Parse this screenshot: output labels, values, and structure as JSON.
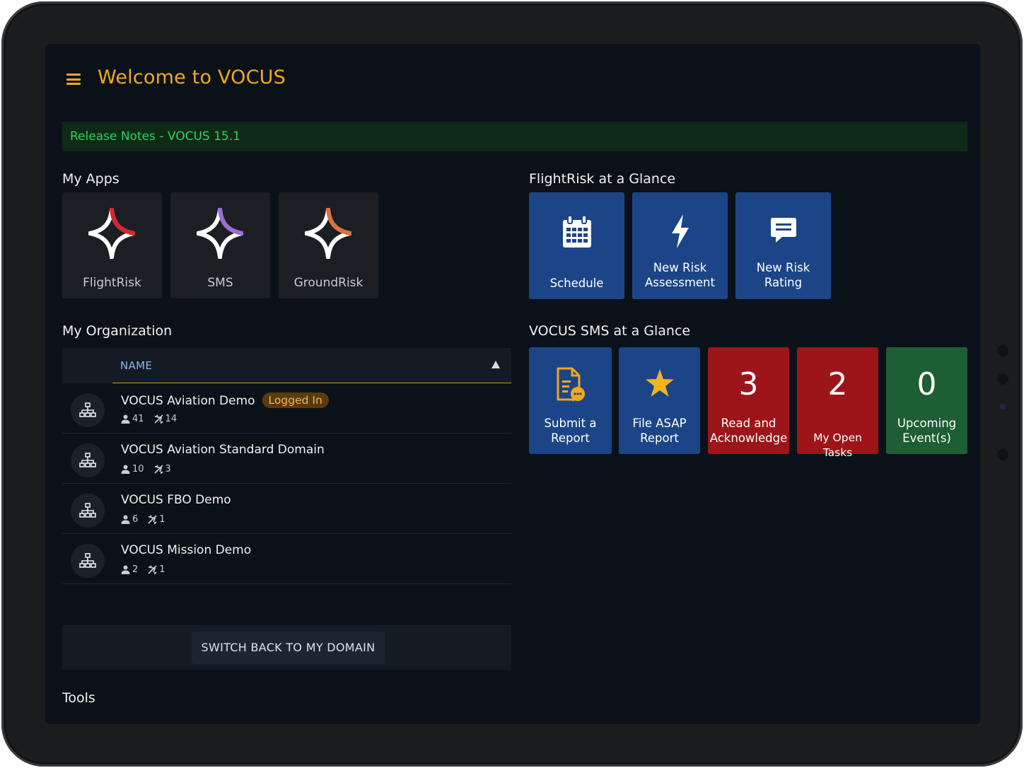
{
  "header": {
    "menu_icon": "hamburger-icon",
    "title": "Welcome to VOCUS"
  },
  "release_notes": "Release Notes - VOCUS 15.1",
  "my_apps": {
    "title": "My Apps",
    "apps": [
      {
        "label": "FlightRisk",
        "icon": "vocus-star-icon",
        "accent": "#d9262c"
      },
      {
        "label": "SMS",
        "icon": "vocus-star-icon",
        "accent": "#9a6dd7"
      },
      {
        "label": "GroundRisk",
        "icon": "vocus-star-icon",
        "accent": "#e0703a"
      }
    ]
  },
  "flightrisk_glance": {
    "title": "FlightRisk at a Glance",
    "tiles": [
      {
        "label": "Schedule",
        "icon": "calendar-icon"
      },
      {
        "label_line1": "New Risk",
        "label_line2": "Assessment",
        "icon": "lightning-icon"
      },
      {
        "label_line1": "New Risk",
        "label_line2": "Rating",
        "icon": "comment-icon"
      }
    ]
  },
  "sms_glance": {
    "title": "VOCUS SMS at a Glance",
    "tiles": [
      {
        "label_line1": "Submit a",
        "label_line2": "Report",
        "icon": "report-icon"
      },
      {
        "label_line1": "File ASAP",
        "label_line2": "Report",
        "icon": "star-icon"
      },
      {
        "count": "3",
        "label_line1": "Read and",
        "label_line2": "Acknowledge",
        "color": "#9d1519"
      },
      {
        "count": "2",
        "label_line1": "My Open Tasks",
        "color": "#9d1519"
      },
      {
        "count": "0",
        "label_line1": "Upcoming",
        "label_line2": "Event(s)",
        "color": "#1d5e34"
      }
    ]
  },
  "my_organization": {
    "title": "My Organization",
    "column_name": "NAME",
    "rows": [
      {
        "name": "VOCUS Aviation Demo",
        "badge": "Logged In",
        "users": "41",
        "aircraft": "14"
      },
      {
        "name": "VOCUS Aviation Standard Domain",
        "users": "10",
        "aircraft": "3"
      },
      {
        "name": "VOCUS FBO Demo",
        "users": "6",
        "aircraft": "1"
      },
      {
        "name": "VOCUS Mission Demo",
        "users": "2",
        "aircraft": "1"
      }
    ]
  },
  "switch_button": "SWITCH BACK TO MY DOMAIN",
  "tools": {
    "title": "Tools"
  },
  "colors": {
    "accent": "#f2a81d",
    "tile_blue": "#1c4588",
    "tile_red": "#9d1519",
    "tile_green": "#1d5e34",
    "release_green": "#2ed15f"
  }
}
